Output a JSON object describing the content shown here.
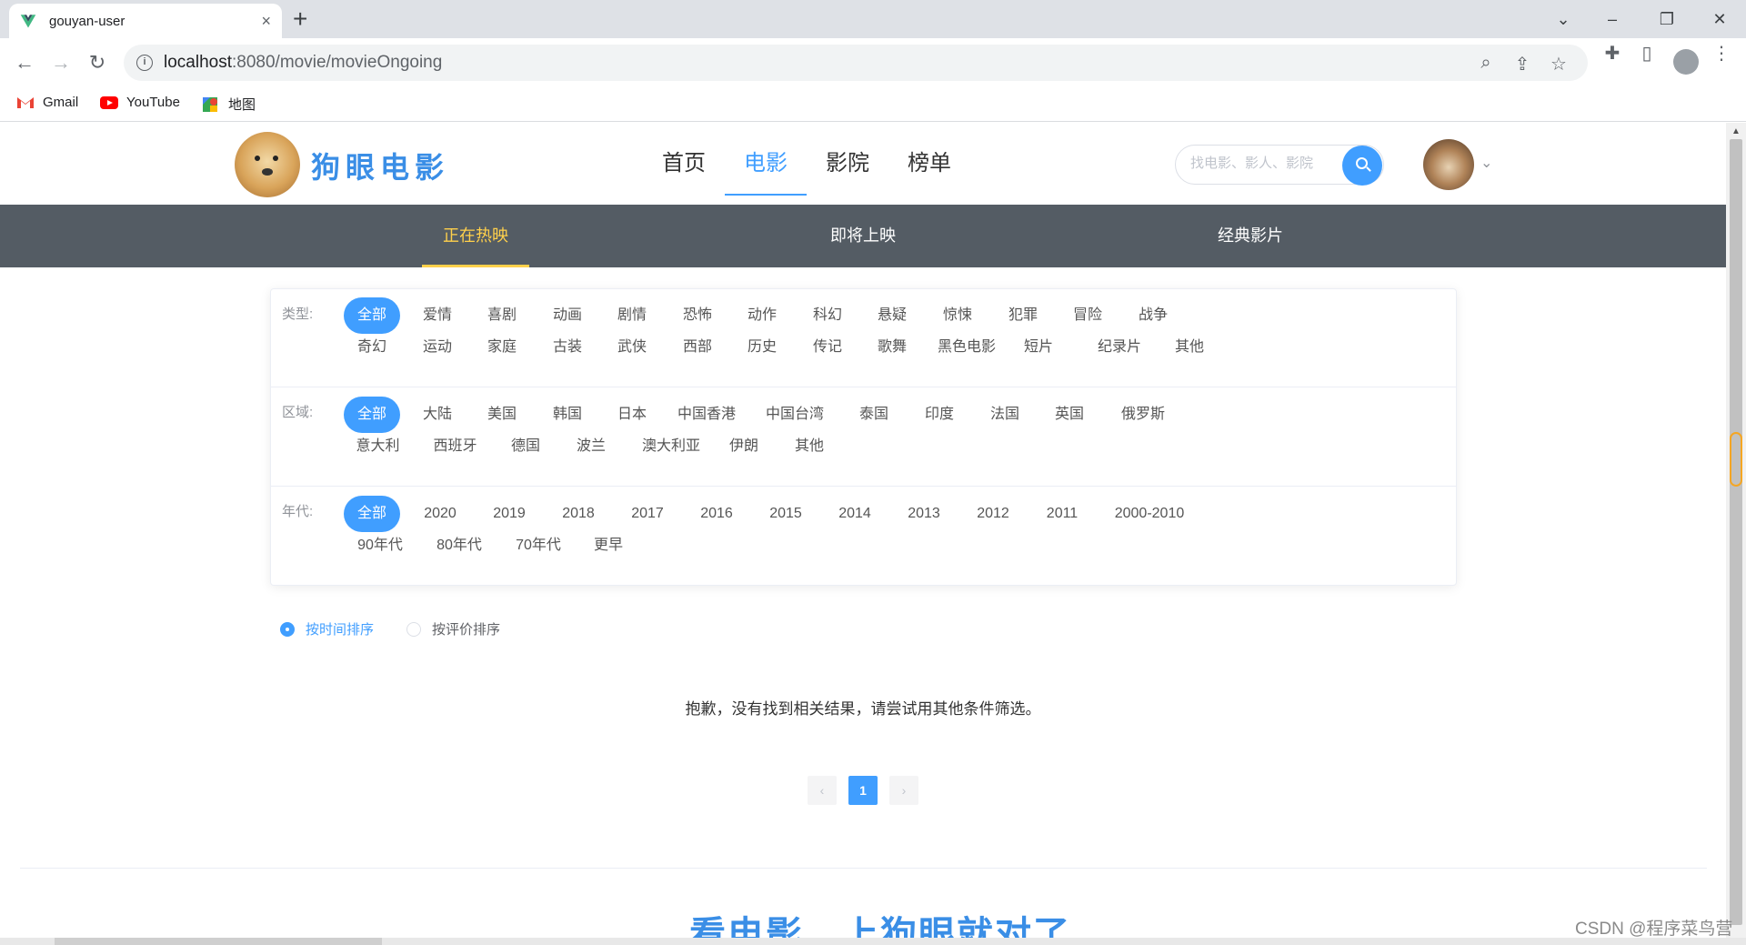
{
  "browser": {
    "tab_title": "gouyan-user",
    "tab_close": "×",
    "new_tab": "+",
    "url_host": "localhost",
    "url_path": ":8080/movie/movieOngoing",
    "bookmarks": [
      {
        "label": "Gmail"
      },
      {
        "label": "YouTube"
      },
      {
        "label": "地图"
      }
    ]
  },
  "header": {
    "logo_text": "狗眼电影",
    "nav": [
      {
        "label": "首页"
      },
      {
        "label": "电影",
        "active": true
      },
      {
        "label": "影院"
      },
      {
        "label": "榜单"
      }
    ],
    "search_placeholder": "找电影、影人、影院"
  },
  "subnav": [
    {
      "label": "正在热映",
      "active": true
    },
    {
      "label": "即将上映"
    },
    {
      "label": "经典影片"
    }
  ],
  "filters": {
    "type": {
      "label": "类型:",
      "options": [
        "全部",
        "爱情",
        "喜剧",
        "动画",
        "剧情",
        "恐怖",
        "动作",
        "科幻",
        "悬疑",
        "惊悚",
        "犯罪",
        "冒险",
        "战争",
        "奇幻",
        "运动",
        "家庭",
        "古装",
        "武侠",
        "西部",
        "历史",
        "传记",
        "歌舞",
        "黑色电影",
        "短片",
        "纪录片",
        "其他"
      ]
    },
    "region": {
      "label": "区域:",
      "options": [
        "全部",
        "大陆",
        "美国",
        "韩国",
        "日本",
        "中国香港",
        "中国台湾",
        "泰国",
        "印度",
        "法国",
        "英国",
        "俄罗斯",
        "意大利",
        "西班牙",
        "德国",
        "波兰",
        "澳大利亚",
        "伊朗",
        "其他"
      ]
    },
    "year": {
      "label": "年代:",
      "options": [
        "全部",
        "2020",
        "2019",
        "2018",
        "2017",
        "2016",
        "2015",
        "2014",
        "2013",
        "2012",
        "2011",
        "2000-2010",
        "90年代",
        "80年代",
        "70年代",
        "更早"
      ]
    },
    "selected": "全部"
  },
  "sort": [
    {
      "label": "按时间排序",
      "checked": true
    },
    {
      "label": "按评价排序",
      "checked": false
    }
  ],
  "empty_message": "抱歉，没有找到相关结果，请尝试用其他条件筛选。",
  "pagination": {
    "prev": "‹",
    "current": "1",
    "next": "›"
  },
  "footer_slogan": "看电影，上狗眼就对了",
  "watermark": "CSDN @程序菜鸟营",
  "colors": {
    "accent": "#409eff",
    "subnav_bg": "#545c64",
    "subnav_active": "#ffd04b"
  }
}
